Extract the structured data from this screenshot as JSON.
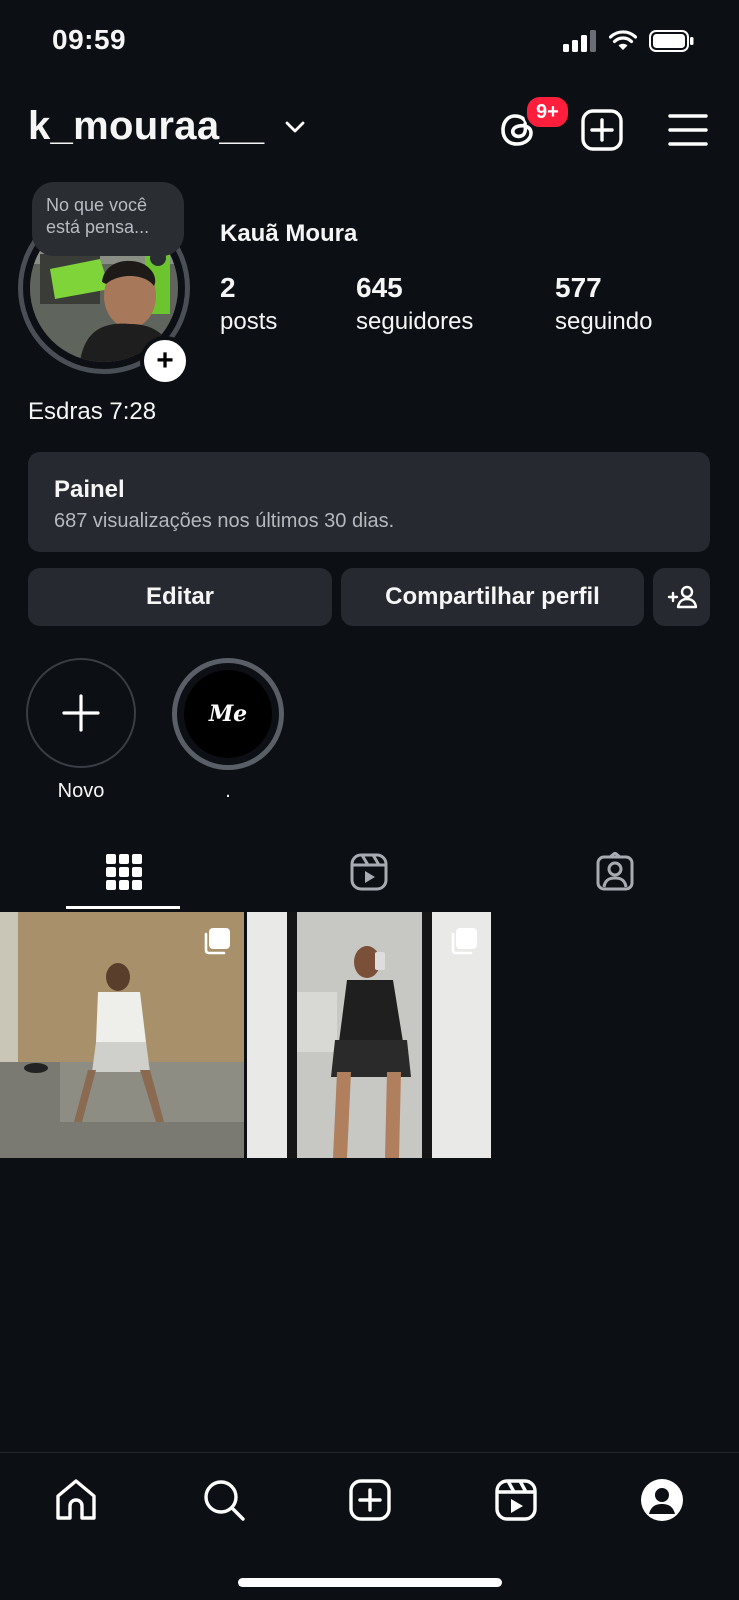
{
  "status_bar": {
    "time": "09:59"
  },
  "header": {
    "username": "k_mouraa__",
    "threads_badge": "9+"
  },
  "profile": {
    "note": "No que você está pensa...",
    "full_name": "Kauã Moura",
    "stats": [
      {
        "value": "2",
        "label": "posts"
      },
      {
        "value": "645",
        "label": "seguidores"
      },
      {
        "value": "577",
        "label": "seguindo"
      }
    ],
    "bio": "Esdras 7:28"
  },
  "dashboard": {
    "title": "Painel",
    "subtitle": "687 visualizações nos últimos 30 dias."
  },
  "actions": {
    "edit": "Editar",
    "share": "Compartilhar perfil"
  },
  "highlights": [
    {
      "label": "Novo"
    },
    {
      "label": ".",
      "cover_text": "Me"
    }
  ],
  "tabs": [
    "grid-icon",
    "reels-icon",
    "tagged-icon"
  ],
  "nav": [
    "home-icon",
    "search-icon",
    "create-icon",
    "reels-icon",
    "profile-icon"
  ]
}
